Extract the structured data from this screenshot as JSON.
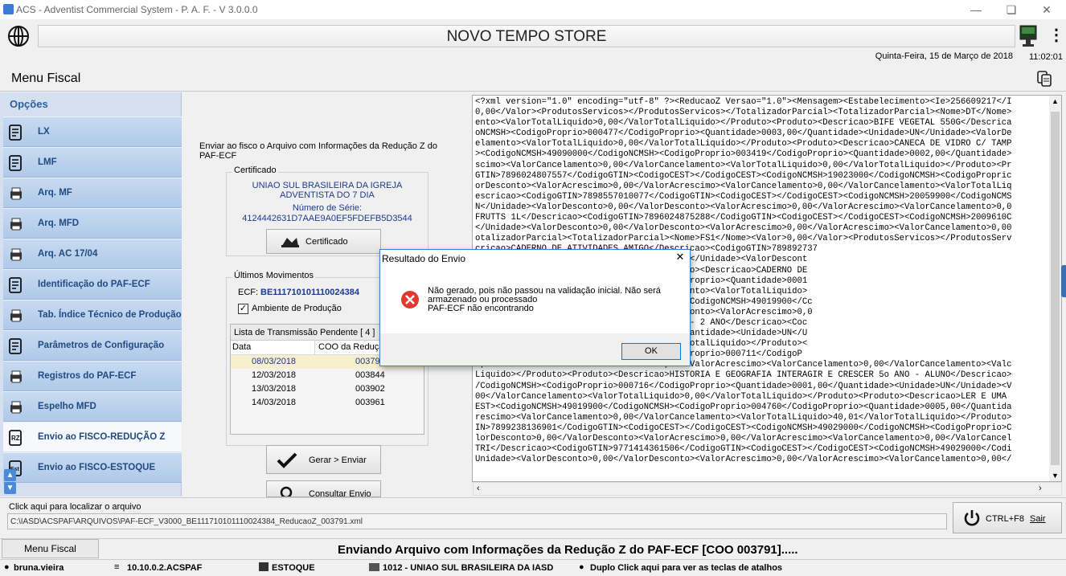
{
  "window": {
    "title": "ACS - Adventist Commercial System - P. A. F. - V 3.0.0.0"
  },
  "header": {
    "store_name": "NOVO TEMPO STORE",
    "date": "Quinta-Feira, 15 de Março de 2018",
    "time": "11:02:01"
  },
  "page": {
    "title": "Menu Fiscal"
  },
  "sidebar": {
    "section_label": "Opções",
    "items": [
      {
        "label": "LX"
      },
      {
        "label": "LMF"
      },
      {
        "label": "Arq. MF"
      },
      {
        "label": "Arq. MFD"
      },
      {
        "label": "Arq. AC 17/04"
      },
      {
        "label": "Identificação do PAF-ECF"
      },
      {
        "label": "Tab. Índice Técnico de Produção"
      },
      {
        "label": "Parâmetros de Configuração"
      },
      {
        "label": "Registros do PAF-ECF"
      },
      {
        "label": "Espelho MFD"
      },
      {
        "label": "Envio ao FISCO-REDUÇÃO Z"
      },
      {
        "label": "Envio ao FISCO-ESTOQUE"
      }
    ]
  },
  "center": {
    "intro": "Enviar ao fisco o Arquivo com Informações da Redução Z do PAF-ECF",
    "cert_group_label": "Certificado",
    "cert_owner": "UNIAO SUL BRASILEIRA DA IGREJA ADVENTISTA DO 7 DIA",
    "serial_label": "Número de Série:",
    "serial_value": "4124442631D7AAE9A0EF5FDEFB5D3544",
    "cert_button": "Certificado",
    "mov_group_label": "Últimos Movimentos",
    "ecf_label": "ECF:",
    "ecf_value": "BE111710101110024384",
    "env_checkbox": "Ambiente de Produção",
    "pending_title": "Lista de Transmissão Pendente [ 4 ]",
    "col_date": "Data",
    "col_coo": "COO da Redução",
    "rows": [
      {
        "date": "08/03/2018",
        "coo": "003791"
      },
      {
        "date": "12/03/2018",
        "coo": "003844"
      },
      {
        "date": "13/03/2018",
        "coo": "003902"
      },
      {
        "date": "14/03/2018",
        "coo": "003961"
      }
    ],
    "send_button": "Gerar > Enviar",
    "query_button": "Consultar Envio"
  },
  "xml_lines": [
    "<?xml version=\"1.0\" encoding=\"utf-8\" ?><ReducaoZ Versao=\"1.0\"><Mensagem><Estabelecimento><Ie>256609217</I",
    "0,00</Valor><ProdutosServicos></ProdutosServicos></TotalizadorParcial><TotalizadorParcial><Nome>DT</Nome>",
    "ento><ValorTotalLiquido>0,00</ValorTotalLiquido></Produto><Produto><Descricao>BIFE VEGETAL 550G</Descrica",
    "oNCMSH><CodigoProprio>000477</CodigoProprio><Quantidade>0003,00</Quantidade><Unidade>UN</Unidade><ValorDe",
    "elamento><ValorTotalLiquido>0,00</ValorTotalLiquido></Produto><Produto><Descricao>CANECA DE VIDRO C/ TAMP",
    "><CodigoNCMSH>49090000</CodigoNCMSH><CodigoProprio>003419</CodigoProprio><Quantidade>0002,00</Quantidade>",
    "scimo><ValorCancelamento>0,00</ValorCancelamento><ValorTotalLiquido>0,00</ValorTotalLiquido></Produto><Pr",
    "GTIN>7896024807557</CodigoGTIN><CodigoCEST></CodigoCEST><CodigoNCMSH>19023000</CodigoNCMSH><CodigoPropric",
    "orDesconto><ValorAcrescimo>0,00</ValorAcrescimo><ValorCancelamento>0,00</ValorCancelamento><ValorTotalLiq",
    "escricao><CodigoGTIN>7898557010077</CodigoGTIN><CodigoCEST></CodigoCEST><CodigoNCMSH>20059900</CodigoNCMS",
    "N</Unidade><ValorDesconto>0,00</ValorDesconto><ValorAcrescimo>0,00</ValorAcrescimo><ValorCancelamento>0,0",
    "FRUTTS 1L</Descricao><CodigoGTIN>7896024875288</CodigoGTIN><CodigoCEST></CodigoCEST><CodigoNCMSH>2009610C",
    "</Unidade><ValorDesconto>0,00</ValorDesconto><ValorAcrescimo>0,00</ValorAcrescimo><ValorCancelamento>0,00",
    "otalizadorParcial><TotalizadorParcial><Nome>FS1</Nome><Valor>0,00</Valor><ProdutosServicos></ProdutosServ",
    "cricao>CADERNO DE ATIVIDADES AMIGO</Descricao><CodigoGTIN>789892737",
    "Quantidade>0006,00</Quantidade><Unidade>UN</Unidade><ValorDescont",
    ">0,00</ValorTotalLiquido></Produto><Produto><Descricao>CADERNO DE",
    "CodigoNCMSH><CodigoProprio>003200</CodigoProprio><Quantidade>0001",
    "mo><ValorCancelamento>0,00</ValorCancelamento><ValorTotalLiquido>",
    "129</CodigoGTIN><CodigoCEST></CodigoCEST><CodigoNCMSH>49019900</Cc",
    "VN</Unidade><ValorDesconto>0,00</ValorDesconto><ValorAcrescimo>0,0",
    "uto><Descricao>ENSINO RELIGIOSO INTERAGIR - 2 ANO</Descricao><Coc",
    "701</CodigoProprio><Quantidade>0001,00</Quantidade><Unidade>UN</U",
    "celamento><ValorTotalLiquido>95,19</ValorTotalLiquido></Produto><",
    "CodigoNCMSH>49019900</CodigoNCMSH><CodigoProprio>000711</CodigoP",
    "0,00</ValorDesconto><ValorAcrescimo>0,00</ValorAcrescimo><ValorCancelamento>0,00</ValorCancelamento><Valc",
    "Liquido></Produto><Produto><Descricao>HISTORIA E GEOGRAFIA INTERAGIR E CRESCER 5o ANO - ALUNO</Descricao>",
    "/CodigoNCMSH><CodigoProprio>000716</CodigoProprio><Quantidade>0001,00</Quantidade><Unidade>UN</Unidade><V",
    "00</ValorCancelamento><ValorTotalLiquido>0,00</ValorTotalLiquido></Produto><Produto><Descricao>LER E UMA",
    "EST><CodigoNCMSH>49019900</CodigoNCMSH><CodigoProprio>004760</CodigoProprio><Quantidade>0005,00</Quantida",
    "rescimo><ValorCancelamento>0,00</ValorCancelamento><ValorTotalLiquido>40,01</ValorTotalLiquido></Produto>",
    "IN>7899238136901</CodigoGTIN><CodigoCEST></CodigoCEST><CodigoNCMSH>49029000</CodigoNCMSH><CodigoProprio>C",
    "lorDesconto>0,00</ValorDesconto><ValorAcrescimo>0,00</ValorAcrescimo><ValorCancelamento>0,00</ValorCancel",
    "TRI</Descricao><CodigoGTIN>9771414361506</CodigoGTIN><CodigoCEST></CodigoCEST><CodigoNCMSH>49029000</Codi",
    "Unidade><ValorDesconto>0,00</ValorDesconto><ValorAcrescimo>0,00</ValorAcrescimo><ValorCancelamento>0,00</"
  ],
  "dialog": {
    "title": "Resultado do Envio",
    "line1": "Não gerado, pois não passou na validação inicial. Não será",
    "line2": "armazenado ou processado",
    "line3": "PAF-ECF não encontrando",
    "ok_label": "OK"
  },
  "file": {
    "hint": "Click aqui para localizar o arquivo",
    "path": "C:\\IASD\\ACSPAF\\ARQUIVOS\\PAF-ECF_V3000_BE111710101110024384_ReducaoZ_003791.xml"
  },
  "exit": {
    "shortcut": "CTRL+F8",
    "label": "Sair"
  },
  "footer": {
    "menu_tab": "Menu Fiscal",
    "message": "Enviando Arquivo com Informações da Redução Z do PAF-ECF [COO 003791]....."
  },
  "status": {
    "user": "bruna.vieira",
    "server": "10.10.0.2.ACSPAF",
    "module": "ESTOQUE",
    "company": "1012 - UNIAO SUL BRASILEIRA DA IASD",
    "hint": "Duplo Click aqui para ver as teclas de atalhos"
  },
  "colors": {
    "accent_blue": "#1f4a82",
    "sidebar_bg": "#d4e0ef",
    "error_red": "#e03a2f",
    "ecf_blue": "#1c3a8c"
  }
}
